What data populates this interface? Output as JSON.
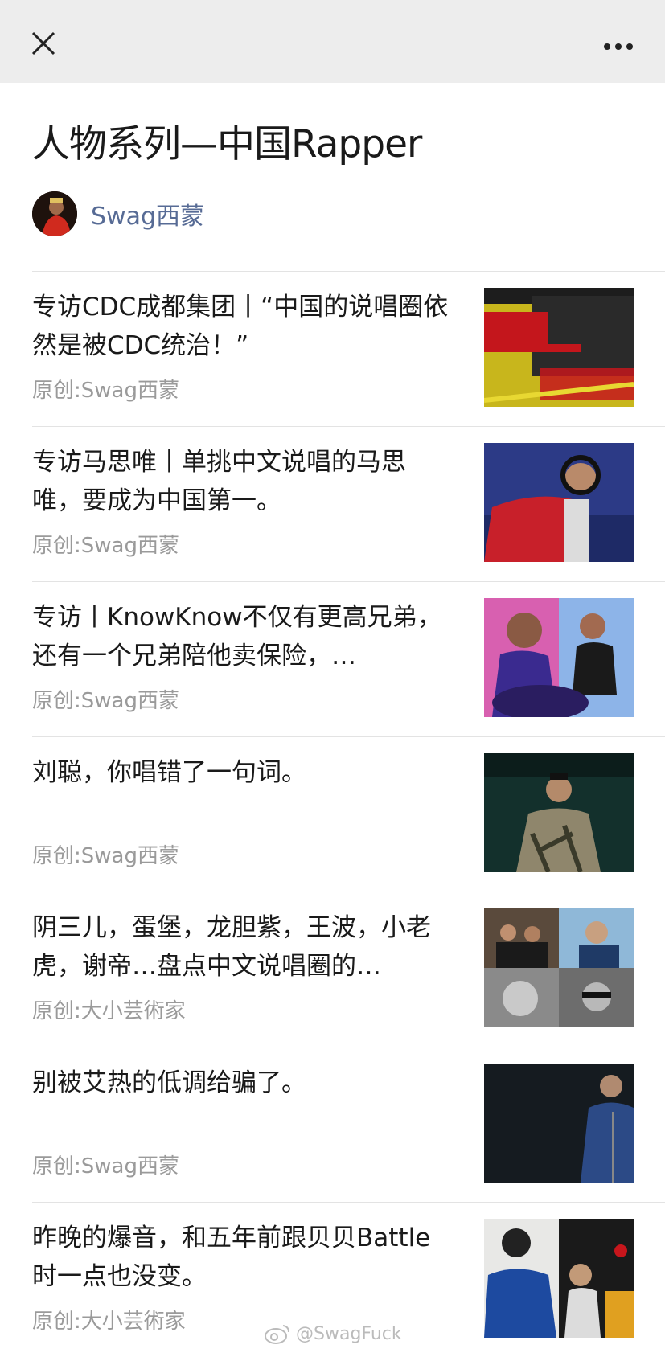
{
  "header": {
    "close_icon": "close-icon",
    "more_icon": "more-dots-icon"
  },
  "page": {
    "title": "人物系列—中国Rapper"
  },
  "author": {
    "name": "Swag西蒙"
  },
  "articles": [
    {
      "title": "专访CDC成都集团丨“中国的说唱圈依然是被CDC统治！”",
      "source": "原创:Swag西蒙",
      "thumb_colors": [
        "#d8c21f",
        "#c4161c"
      ]
    },
    {
      "title": "专访马思唯丨单挑中文说唱的马思唯，要成为中国第一。",
      "source": "原创:Swag西蒙",
      "thumb_colors": [
        "#2c3a86",
        "#c8202a"
      ]
    },
    {
      "title": "专访丨KnowKnow不仅有更高兄弟，还有一个兄弟陪他卖保险，…",
      "source": "原创:Swag西蒙",
      "thumb_colors": [
        "#e25aa8",
        "#3a2a8f"
      ]
    },
    {
      "title": "刘聪，你唱错了一句词。",
      "source": "原创:Swag西蒙",
      "thumb_colors": [
        "#13302c",
        "#9a8f6e"
      ]
    },
    {
      "title": "阴三儿，蛋堡，龙胆紫，王波，小老虎，谢帝…盘点中文说唱圈的…",
      "source": "原创:大小芸術家",
      "thumb_colors": [
        "#5a4a3c",
        "#7f7f7f"
      ]
    },
    {
      "title": "别被艾热的低调给骗了。",
      "source": "原创:Swag西蒙",
      "thumb_colors": [
        "#151b20",
        "#2c4a86"
      ]
    },
    {
      "title": "昨晚的爆音，和五年前跟贝贝Battle时一点也没变。",
      "source": "原创:大小芸術家",
      "thumb_colors": [
        "#1d4aa0",
        "#c7161c"
      ]
    }
  ],
  "watermark": {
    "text": "@SwagFuck",
    "icon": "weibo-icon"
  }
}
